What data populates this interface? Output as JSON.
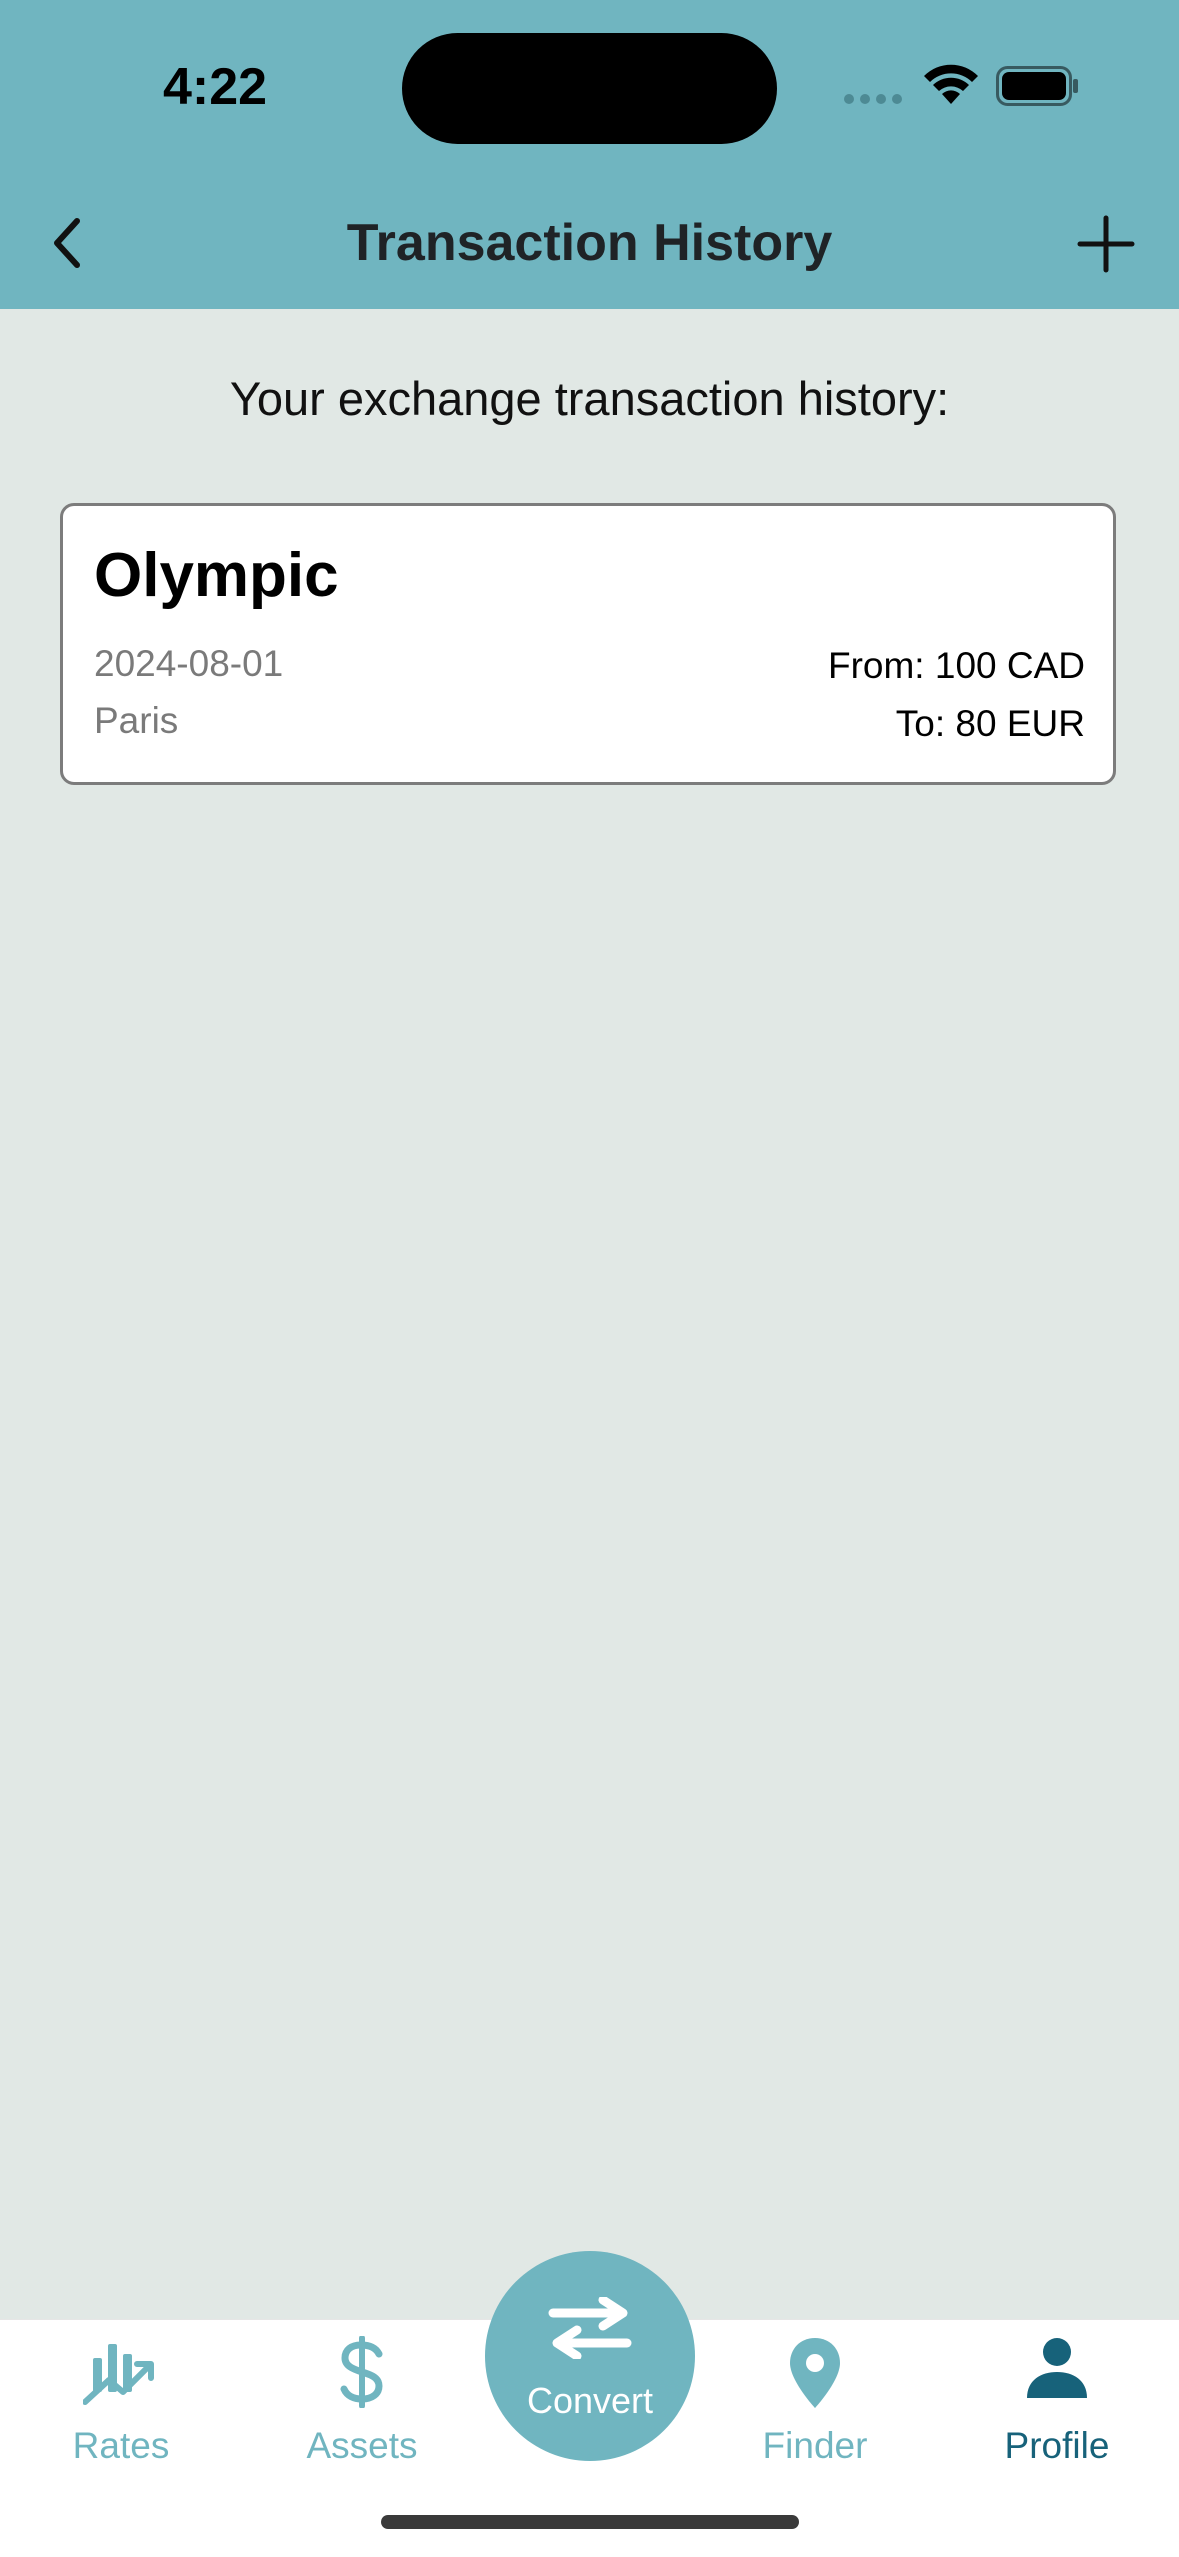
{
  "status_bar": {
    "time": "4:22"
  },
  "header": {
    "title": "Transaction History",
    "back_icon": "chevron-left-icon",
    "add_icon": "plus-icon"
  },
  "main": {
    "subtitle": "Your exchange transaction history:",
    "transactions": [
      {
        "title": "Olympic",
        "date": "2024-08-01",
        "location": "Paris",
        "from": "From: 100 CAD",
        "to": "To: 80 EUR"
      }
    ]
  },
  "tabbar": {
    "tabs": [
      {
        "label": "Rates",
        "icon": "chart-trend-icon",
        "active": false
      },
      {
        "label": "Assets",
        "icon": "dollar-icon",
        "active": false
      },
      {
        "label": "Convert",
        "icon": "swap-arrows-icon",
        "active": false
      },
      {
        "label": "Finder",
        "icon": "map-pin-icon",
        "active": false
      },
      {
        "label": "Profile",
        "icon": "person-icon",
        "active": true
      }
    ]
  },
  "colors": {
    "header_bg": "#70b5c0",
    "page_bg": "#e1e8e5",
    "tab_inactive": "#70b5c0",
    "tab_active": "#17627a"
  }
}
